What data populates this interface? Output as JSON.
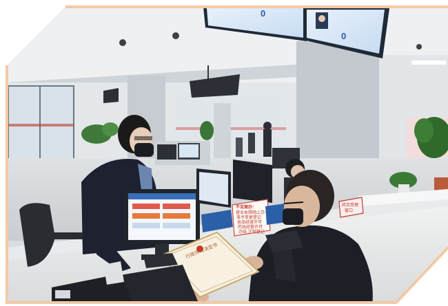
{
  "photo": {
    "overhead_display": {
      "left_counter": "0",
      "right_counter": "0"
    },
    "desk_sign": {
      "title": "不见面办：",
      "lines": [
        "营业执照网上办",
        "准予变更登记",
        "食品经营许可",
        "药品经营许可",
        "办结 注销登记"
      ]
    },
    "certificate": {
      "title": "行政许可决定书"
    },
    "red_label": {
      "lines": [
        "综合受理",
        "窗口"
      ]
    }
  }
}
